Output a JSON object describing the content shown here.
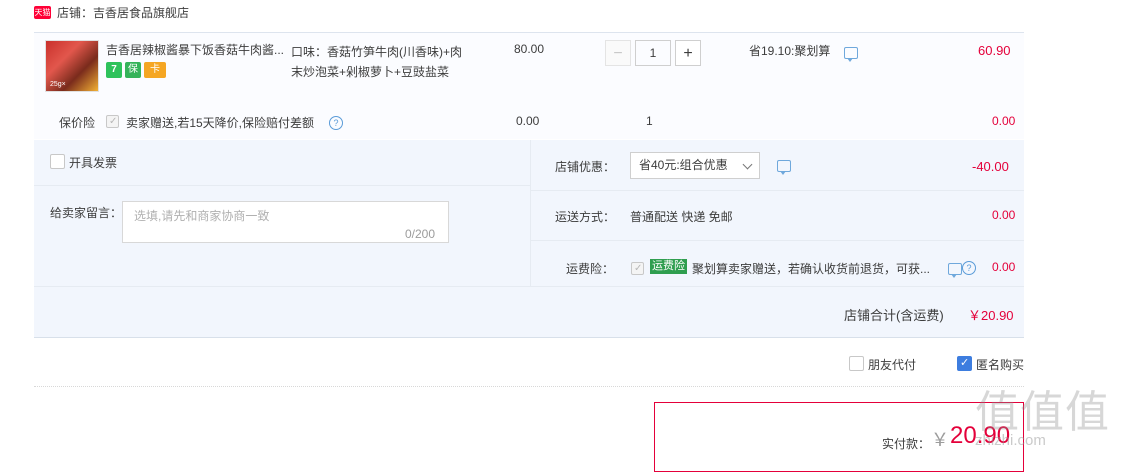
{
  "shop": {
    "badge": "天猫",
    "title": "店铺：吉香居食品旗舰店"
  },
  "product": {
    "name": "吉香居辣椒酱暴下饭香菇牛肉酱...",
    "thumb_label": "25g×",
    "service_icons": [
      "7",
      "保",
      "卡"
    ],
    "sku_line1": "口味：香菇竹笋牛肉(川香味)+肉",
    "sku_line2": "末炒泡菜+剁椒萝卜+豆豉盐菜",
    "unit_price": "80.00",
    "quantity": "1",
    "qty_minus": "−",
    "qty_plus": "+",
    "promo": "省19.10:聚划算",
    "subtotal": "60.90"
  },
  "insurance": {
    "label": "保价险",
    "desc": "卖家赠送,若15天降价,保险赔付差额",
    "help": "?",
    "price": "0.00",
    "qty": "1",
    "total": "0.00"
  },
  "invoice": {
    "label": "开具发票"
  },
  "memo": {
    "label": "给卖家留言：",
    "placeholder": "选填,请先和商家协商一致",
    "count": "0/200"
  },
  "discount": {
    "label": "店铺优惠：",
    "selected": "省40元:组合优惠",
    "amount": "-40.00"
  },
  "shipping": {
    "label": "运送方式：",
    "value": "普通配送 快递 免邮",
    "amount": "0.00"
  },
  "freight_insurance": {
    "label": "运费险：",
    "tag": "运费险",
    "desc": "聚划算卖家赠送，若确认收货前退货，可获...",
    "help": "?",
    "amount": "0.00"
  },
  "shop_total": {
    "label": "店铺合计(含运费)",
    "value": "￥20.90"
  },
  "options": {
    "friend_pay": "朋友代付",
    "anonymous": "匿名购买"
  },
  "payment": {
    "label": "实付款：",
    "currency": "￥",
    "amount": "20.90"
  },
  "watermark": {
    "logo": "值值值",
    "site": "zhizhi.com"
  },
  "colors": {
    "accent_red": "#e4003a",
    "tmall_red": "#ff0036",
    "panel_blue": "#f2f6fd",
    "check_blue": "#3d7ddf",
    "freight_green": "#2f9e4f"
  }
}
